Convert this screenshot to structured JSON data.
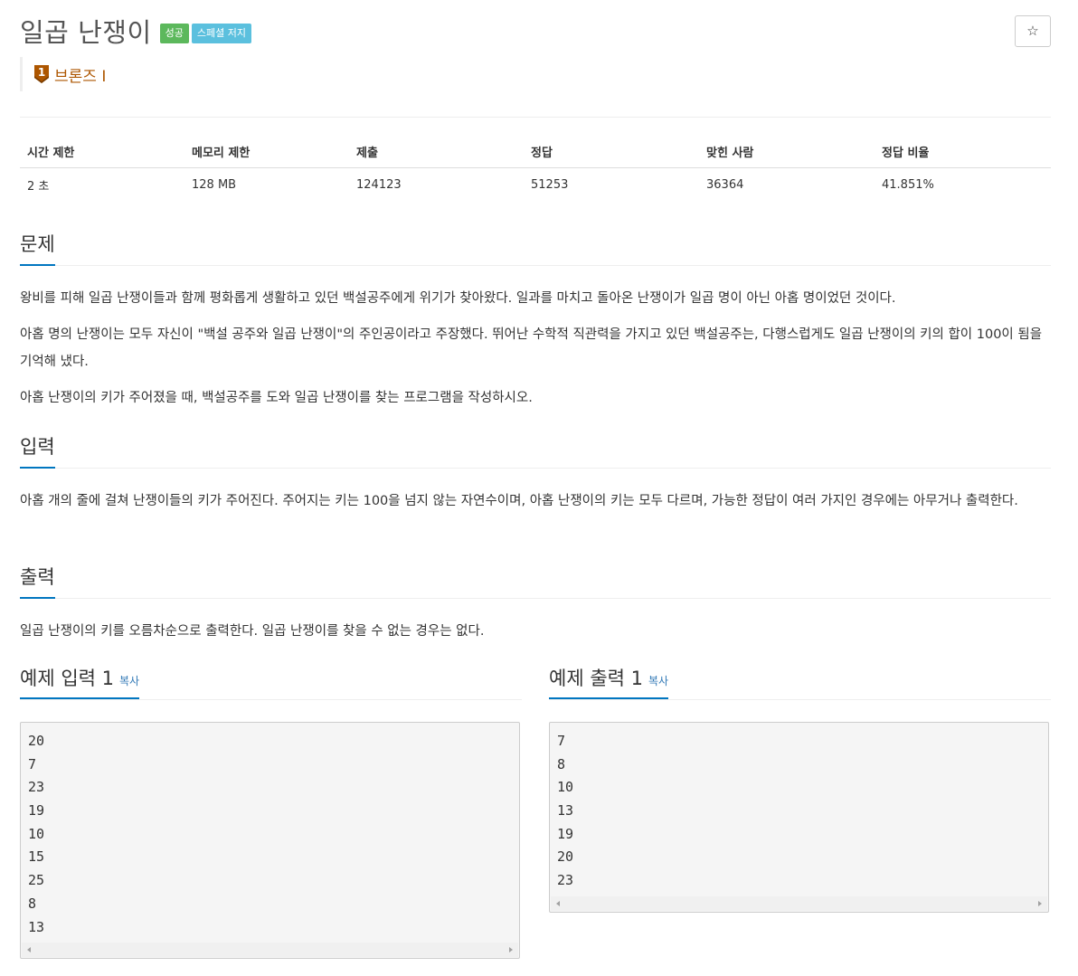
{
  "problem": {
    "title": "일곱 난쟁이",
    "badge_success": "성공",
    "badge_special": "스페셜 저지",
    "star_icon": "☆",
    "tier": {
      "icon_number": "1",
      "label": "브론즈 I",
      "color": "#ad5600"
    }
  },
  "info": {
    "headers": [
      "시간 제한",
      "메모리 제한",
      "제출",
      "정답",
      "맞힌 사람",
      "정답 비율"
    ],
    "values": [
      "2 초",
      "128 MB",
      "124123",
      "51253",
      "36364",
      "41.851%"
    ]
  },
  "description": {
    "heading": "문제",
    "paragraphs": [
      "왕비를 피해 일곱 난쟁이들과 함께 평화롭게 생활하고 있던 백설공주에게 위기가 찾아왔다. 일과를 마치고 돌아온 난쟁이가 일곱 명이 아닌 아홉 명이었던 것이다.",
      "아홉 명의 난쟁이는 모두 자신이 \"백설 공주와 일곱 난쟁이\"의 주인공이라고 주장했다. 뛰어난 수학적 직관력을 가지고 있던 백설공주는, 다행스럽게도 일곱 난쟁이의 키의 합이 100이 됨을 기억해 냈다.",
      "아홉 난쟁이의 키가 주어졌을 때, 백설공주를 도와 일곱 난쟁이를 찾는 프로그램을 작성하시오."
    ]
  },
  "input": {
    "heading": "입력",
    "text": "아홉 개의 줄에 걸쳐 난쟁이들의 키가 주어진다. 주어지는 키는 100을 넘지 않는 자연수이며, 아홉 난쟁이의 키는 모두 다르며, 가능한 정답이 여러 가지인 경우에는 아무거나 출력한다."
  },
  "output": {
    "heading": "출력",
    "text": "일곱 난쟁이의 키를 오름차순으로 출력한다. 일곱 난쟁이를 찾을 수 없는 경우는 없다."
  },
  "samples": {
    "input": {
      "heading": "예제 입력 1",
      "copy_label": "복사",
      "lines": [
        "20",
        "7",
        "23",
        "19",
        "10",
        "15",
        "25",
        "8",
        "13"
      ]
    },
    "output": {
      "heading": "예제 출력 1",
      "copy_label": "복사",
      "lines": [
        "7",
        "8",
        "10",
        "13",
        "19",
        "20",
        "23"
      ]
    }
  },
  "colors": {
    "accent": "#0076c0",
    "success": "#5cb85c",
    "info": "#5bc0de",
    "link": "#337ab7"
  }
}
